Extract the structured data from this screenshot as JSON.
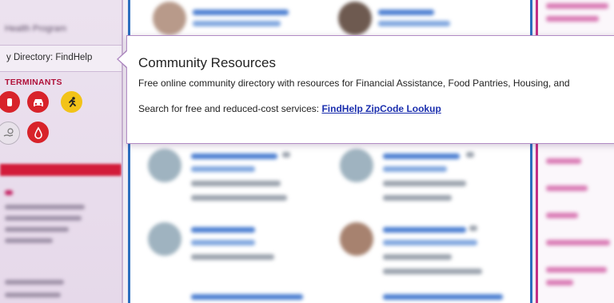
{
  "sidebar": {
    "top_item": "Health Program",
    "directory_label": "y Directory: FindHelp",
    "section_title": "TERMINANTS",
    "icons": [
      {
        "name": "hand-icon",
        "color": "#d8232a"
      },
      {
        "name": "car-icon",
        "color": "#d8232a"
      },
      {
        "name": "runner-icon",
        "color": "#f2c318"
      },
      {
        "name": "hand-coin-icon",
        "color": "#8e8e8e"
      },
      {
        "name": "blood-drop-icon",
        "color": "#d8232a"
      }
    ]
  },
  "popover": {
    "title": "Community Resources",
    "description": "Free online community directory with resources for Financial Assistance, Food Pantries, Housing, and",
    "search_prefix": "Search for free and reduced-cost services: ",
    "search_link": "FindHelp ZipCode Lookup"
  },
  "colors": {
    "main_border": "#2c6fbf",
    "right_border": "#c22f84",
    "link": "#1b2fae",
    "sidebar_accent": "#d21c3a"
  }
}
